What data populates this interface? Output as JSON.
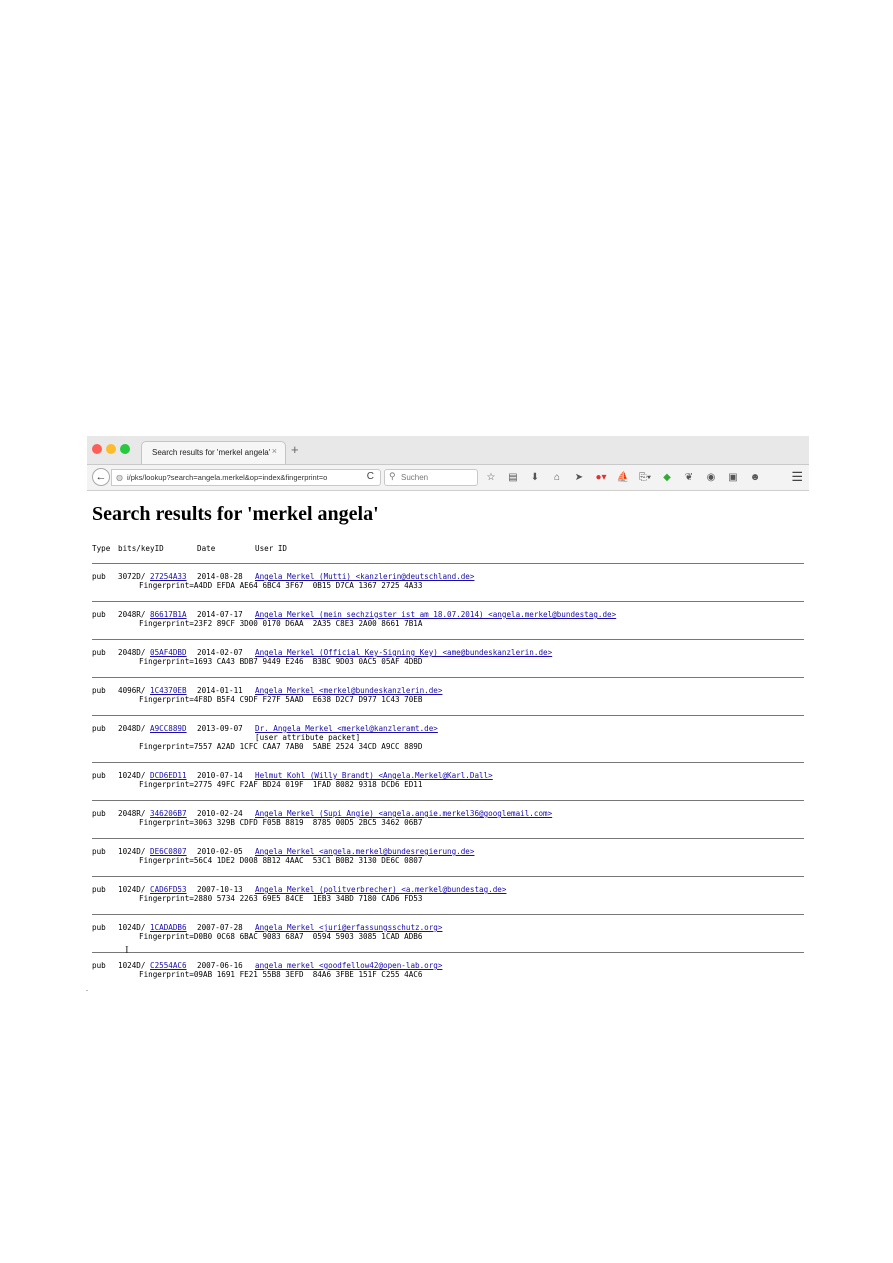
{
  "browser": {
    "tab_title": "Search results for 'merkel angela'",
    "tab_close": "×",
    "new_tab": "+",
    "back": "←",
    "url": "i/pks/lookup?search=angela.merkel&op=index&fingerprint=o",
    "reload": "C",
    "search_placeholder": "Suchen",
    "menu": "☰"
  },
  "page": {
    "title": "Search results for 'merkel angela'",
    "columns": {
      "type": "Type",
      "bits_keyid": "bits/keyID",
      "date": "Date",
      "user_id": "User ID"
    }
  },
  "results": [
    {
      "type": "pub",
      "bits": "3072D/",
      "keyid": "27254A33",
      "date": "2014-08-28",
      "uid": "Angela Merkel (Mutti) <kanzlerin@deutschland.de>",
      "extra": "",
      "fingerprint": "Fingerprint=A4DD EFDA AE64 6BC4 3F67  0B15 D7CA 1367 2725 4A33"
    },
    {
      "type": "pub",
      "bits": "2048R/",
      "keyid": "86617B1A",
      "date": "2014-07-17",
      "uid": "Angela Merkel (mein sechzigster ist am 18.07.2014) <angela.merkel@bundestag.de>",
      "extra": "",
      "fingerprint": "Fingerprint=23F2 89CF 3D00 0170 D6AA  2A35 C8E3 2A00 8661 7B1A"
    },
    {
      "type": "pub",
      "bits": "2048D/",
      "keyid": "05AF4DBD",
      "date": "2014-02-07",
      "uid": "Angela Merkel (Official Key-Signing Key) <ame@bundeskanzlerin.de>",
      "extra": "",
      "fingerprint": "Fingerprint=1693 CA43 BDB7 9449 E246  B3BC 9D03 0AC5 05AF 4DBD"
    },
    {
      "type": "pub",
      "bits": "4096R/",
      "keyid": "1C4370EB",
      "date": "2014-01-11",
      "uid": "Angela Merkel <merkel@bundeskanzlerin.de>",
      "extra": "",
      "fingerprint": "Fingerprint=4F8D B5F4 C9DF F27F 5AAD  E638 D2C7 D977 1C43 70EB"
    },
    {
      "type": "pub",
      "bits": "2048D/",
      "keyid": "A9CC889D",
      "date": "2013-09-07",
      "uid": "Dr. Angela Merkel <merkel@kanzleramt.de>",
      "extra": "[user attribute packet]",
      "fingerprint": "Fingerprint=7557 A2AD 1CFC CAA7 7AB0  5ABE 2524 34CD A9CC 889D"
    },
    {
      "type": "pub",
      "bits": "1024D/",
      "keyid": "DCD6ED11",
      "date": "2010-07-14",
      "uid": "Helmut Kohl (Willy Brandt) <Angela.Merkel@Karl.Dall>",
      "extra": "",
      "fingerprint": "Fingerprint=2775 49FC F2AF BD24 019F  1FAD 8082 9318 DCD6 ED11"
    },
    {
      "type": "pub",
      "bits": "2048R/",
      "keyid": "346206B7",
      "date": "2010-02-24",
      "uid": "Angela Merkel (Supi Angie) <angela.angie.merkel36@googlemail.com>",
      "extra": "",
      "fingerprint": "Fingerprint=3063 329B CDFD F05B 8819  8785 00D5 2BC5 3462 06B7"
    },
    {
      "type": "pub",
      "bits": "1024D/",
      "keyid": "DE6C0807",
      "date": "2010-02-05",
      "uid": "Angela Merkel <angela.merkel@bundesregierung.de>",
      "extra": "",
      "fingerprint": "Fingerprint=56C4 1DE2 D008 8B12 4AAC  53C1 B0B2 3130 DE6C 0807"
    },
    {
      "type": "pub",
      "bits": "1024D/",
      "keyid": "CAD6FD53",
      "date": "2007-10-13",
      "uid": "Angela Merkel (politverbrecher) <a.merkel@bundestag.de>",
      "extra": "",
      "fingerprint": "Fingerprint=2880 5734 2263 69E5 84CE  1EB3 34BD 7180 CAD6 FD53"
    },
    {
      "type": "pub",
      "bits": "1024D/",
      "keyid": "1CADADB6",
      "date": "2007-07-28",
      "uid": "Angela Merkel <juri@erfassungsschutz.org>",
      "extra": "",
      "fingerprint": "Fingerprint=D0B0 0C68 6BAC 9083 68A7  0594 5903 3085 1CAD ADB6"
    },
    {
      "type": "pub",
      "bits": "1024D/",
      "keyid": "C2554AC6",
      "date": "2007-06-16",
      "uid": "angela merkel <goodfellow42@open-lab.org>",
      "extra": "",
      "fingerprint": "Fingerprint=09AB 1691 FE21 55B8 3EFD  84A6 3FBE 151F C255 4AC6"
    }
  ]
}
